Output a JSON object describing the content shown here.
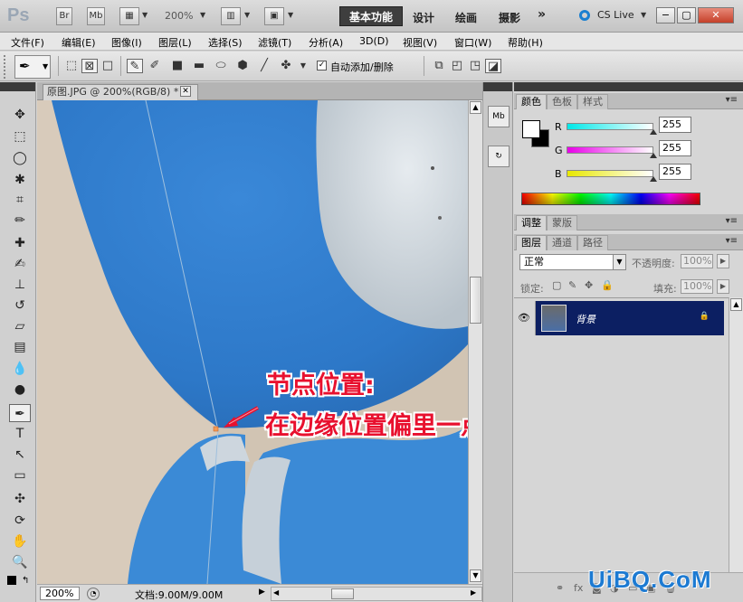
{
  "app": {
    "logo": "Ps",
    "bridge_button": "Br",
    "minibridge_button": "Mb",
    "zoom_level": "200%",
    "workspaces": {
      "active": "基本功能",
      "design": "设计",
      "painting": "绘画",
      "photography": "摄影",
      "more": "»"
    },
    "cs_live": "CS Live",
    "window_controls": {
      "minimize": "−",
      "maximize": "▢",
      "close": "✕"
    }
  },
  "menu": [
    "文件(F)",
    "编辑(E)",
    "图像(I)",
    "图层(L)",
    "选择(S)",
    "滤镜(T)",
    "分析(A)",
    "3D(D)",
    "视图(V)",
    "窗口(W)",
    "帮助(H)"
  ],
  "options": {
    "auto_add_delete_label": "自动添加/删除",
    "auto_add_delete_checked": true
  },
  "document": {
    "tab_title": "原图.JPG @ 200%(RGB/8) *",
    "zoom": "200%",
    "status": "文档:9.00M/9.00M",
    "annotation_line1": "节点位置:",
    "annotation_line2": "在边缘位置偏里一点点!"
  },
  "panels": {
    "color_tabs": [
      "颜色",
      "色板",
      "样式"
    ],
    "adjust_tabs": [
      "调整",
      "蒙版"
    ],
    "layer_tabs": [
      "图层",
      "通道",
      "路径"
    ],
    "channels": [
      {
        "label": "R",
        "value": "255",
        "color": "#00e0e0"
      },
      {
        "label": "G",
        "value": "255",
        "color": "#e000e0"
      },
      {
        "label": "B",
        "value": "255",
        "color": "#e0e000"
      }
    ],
    "blend_mode": "正常",
    "opacity_label": "不透明度:",
    "opacity_value": "100%",
    "lock_label": "锁定:",
    "fill_label": "填充:",
    "fill_value": "100%",
    "layer_name": "背景"
  },
  "watermark": "UiBQ.CoM"
}
